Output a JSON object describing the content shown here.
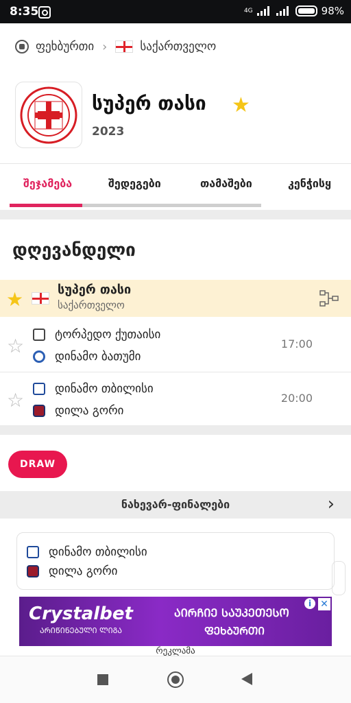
{
  "status": {
    "time": "8:35",
    "network": "4G",
    "battery": "98%"
  },
  "breadcrumb": {
    "sport": "ფეხბურთი",
    "country": "საქართველო"
  },
  "competition": {
    "title": "სუპერ თასი",
    "year": "2023"
  },
  "tabs": [
    "შეჯამება",
    "შედეგები",
    "თამაშები",
    "კენჭისყ"
  ],
  "section_title": "დღევანდელი",
  "league": {
    "name": "სუპერ თასი",
    "country": "საქართველო"
  },
  "matches": [
    {
      "home": "ტორპედო ქუთაისი",
      "away": "დინამო ბათუმი",
      "time": "17:00"
    },
    {
      "home": "დინამო თბილისი",
      "away": "დილა გორი",
      "time": "20:00"
    }
  ],
  "draw_label": "DRAW",
  "round": {
    "label": "ნახევარ-ფინალები"
  },
  "bracket_card": {
    "team1": "დინამო თბილისი",
    "team2": "დილა გორი"
  },
  "ad": {
    "brand": "Crystalbet",
    "sub": "ᲐᲠᲘᲬᲘᲜᲔᲑᲣᲚᲘ ᲚᲘᲒᲐ",
    "headline": "ᲐᲘᲠᲩᲘᲔ ᲡᲐᲣᲙᲔᲗᲔᲡᲝ",
    "headline2": "ᲤᲔᲮᲑᲣᲠᲗᲘ",
    "label": "რეკლამა"
  },
  "colors": {
    "accent": "#e0245e",
    "star": "#f5c518",
    "league_bg": "#fdf1d3"
  },
  "icons": [
    "instagram-icon",
    "soccer-ball-icon",
    "chevron-right-icon",
    "star-icon",
    "bracket-icon",
    "georgia-flag-icon"
  ]
}
